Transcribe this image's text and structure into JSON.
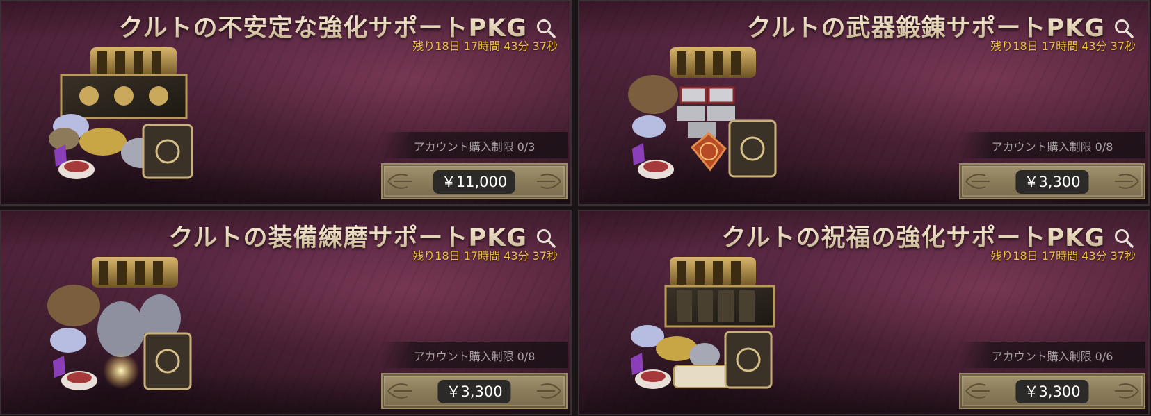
{
  "packages": [
    {
      "title": "クルトの不安定な強化サポートPKG",
      "timer": "残り18日 17時間 43分 37秒",
      "limit": "アカウント購入制限 0/3",
      "price": "￥11,000",
      "icon": "magnifier-icon"
    },
    {
      "title": "クルトの武器鍛錬サポートPKG",
      "timer": "残り18日 17時間 43分 37秒",
      "limit": "アカウント購入制限 0/8",
      "price": "￥3,300",
      "icon": "magnifier-icon"
    },
    {
      "title": "クルトの装備練磨サポートPKG",
      "timer": "残り18日 17時間 43分 37秒",
      "limit": "アカウント購入制限 0/8",
      "price": "￥3,300",
      "icon": "magnifier-icon"
    },
    {
      "title": "クルトの祝福の強化サポートPKG",
      "timer": "残り18日 17時間 43分 37秒",
      "limit": "アカウント購入制限 0/6",
      "price": "￥3,300",
      "icon": "magnifier-icon"
    }
  ],
  "colors": {
    "title": "#e8dcc8",
    "timer": "#f2c33a",
    "limit_text": "#a8a0a2",
    "button_gold": "#8d7e5c",
    "price_pill": "#2b2a29",
    "background_plum": "#4a1f35"
  }
}
